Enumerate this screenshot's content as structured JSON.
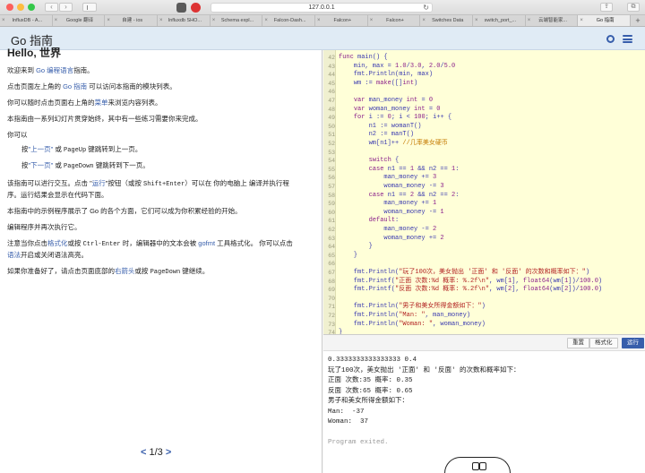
{
  "browser": {
    "url": "127.0.0.1",
    "tabs": [
      "InfluxDB - A...",
      "Google 翻译",
      "自建 - ios",
      "Influxdb SHO...",
      "Schema expl...",
      "Falcon-Dash...",
      "Falcon+",
      "Falcon+",
      "Switches Data",
      "switch_port_...",
      "云端智能家...",
      "Go 指南"
    ],
    "active_tab": 11
  },
  "app": {
    "title": "Go 指南"
  },
  "lesson": {
    "heading": "Hello, 世界",
    "p1": [
      "欢迎来到 ",
      "Go 编程语言",
      "指南。"
    ],
    "p2": [
      "点击页面左上角的 ",
      "Go 指南",
      " 可以访问本指南的模块列表。"
    ],
    "p3": [
      "你可以随时点击页面右上角的",
      "菜单",
      "来浏览内容列表。"
    ],
    "p4": "本指南由一系列幻灯片贯穿始终，其中有一些练习需要你来完成。",
    "p5": "你可以",
    "li1": [
      "按",
      "\"上一页\"",
      " 或 ",
      "PageUp",
      " 键跳转到上一页。"
    ],
    "li2": [
      "按",
      "\"下一页\"",
      " 或 ",
      "PageDown",
      " 键跳转到下一页。"
    ],
    "p6a": [
      "该指南可以进行交互。点击 \"",
      "运行",
      "\"按钮（或按 ",
      "Shift+Enter",
      "）可以在 你的电脑上 编译并执行程"
    ],
    "p6b": "序。运行结果会显示在代码下面。",
    "p7": "本指南中的示例程序展示了 Go 的各个方面，它们可以成为你积累经验的开始。",
    "p8": "编辑程序并再次执行它。",
    "p9a": [
      "注意当你点击",
      "格式化",
      "或按 ",
      "Ctrl-Enter",
      " 时，编辑器中的文本会被 ",
      "gofmt",
      " 工具格式化。 你可以点击"
    ],
    "p9b": [
      "",
      "语法",
      "开启或关闭语法高亮。"
    ],
    "p10": [
      "如果你准备好了，请点击页面底部的",
      "右箭头",
      "或按 ",
      "PageDown",
      " 键继续。"
    ],
    "pager": {
      "prev": "<",
      "page": "1/3",
      "next": ">"
    }
  },
  "editor": {
    "lines": [
      {
        "n": "42",
        "t": "func main() {"
      },
      {
        "n": "43",
        "t": "    min, max = 1.0/3.0, 2.0/5.0"
      },
      {
        "n": "44",
        "t": "    fmt.Println(min, max)"
      },
      {
        "n": "45",
        "t": "    wm := make([]int)"
      },
      {
        "n": "46",
        "t": ""
      },
      {
        "n": "47",
        "t": "    var man_money int = 0"
      },
      {
        "n": "48",
        "t": "    var woman_money int = 0"
      },
      {
        "n": "49",
        "t": "    for i := 0; i < 100; i++ {"
      },
      {
        "n": "50",
        "t": "        n1 := womanT()"
      },
      {
        "n": "51",
        "t": "        n2 := manT()"
      },
      {
        "n": "52",
        "t": "        wm[n1]++ //几率美女硬币"
      },
      {
        "n": "53",
        "t": ""
      },
      {
        "n": "54",
        "t": "        switch {"
      },
      {
        "n": "55",
        "t": "        case n1 == 1 && n2 == 1:"
      },
      {
        "n": "56",
        "t": "            man_money += 3"
      },
      {
        "n": "57",
        "t": "            woman_money -= 3"
      },
      {
        "n": "58",
        "t": "        case n1 == 2 && n2 == 2:"
      },
      {
        "n": "59",
        "t": "            man_money += 1"
      },
      {
        "n": "60",
        "t": "            woman_money -= 1"
      },
      {
        "n": "61",
        "t": "        default:"
      },
      {
        "n": "62",
        "t": "            man_money -= 2"
      },
      {
        "n": "63",
        "t": "            woman_money += 2"
      },
      {
        "n": "64",
        "t": "        }"
      },
      {
        "n": "65",
        "t": "    }"
      },
      {
        "n": "66",
        "t": ""
      },
      {
        "n": "67",
        "t": "    fmt.Println(\"玩了100次，美女抛出 '正面' 和 '反面' 的次数和概率如下：\")"
      },
      {
        "n": "68",
        "t": "    fmt.Printf(\"正面 次数:%d 概率: %.2f\\n\", wm[1], float64(wm[1])/100.0)"
      },
      {
        "n": "69",
        "t": "    fmt.Printf(\"反面 次数:%d 概率: %.2f\\n\", wm[2], float64(wm[2])/100.0)"
      },
      {
        "n": "70",
        "t": ""
      },
      {
        "n": "71",
        "t": "    fmt.Println(\"男子和美女所得金额如下：\")"
      },
      {
        "n": "72",
        "t": "    fmt.Println(\"Man: \", man_money)"
      },
      {
        "n": "73",
        "t": "    fmt.Println(\"Woman: \", woman_money)"
      },
      {
        "n": "74",
        "t": "}"
      }
    ]
  },
  "toolbar": {
    "reset": "重置",
    "format": "格式化",
    "run": "运行"
  },
  "output": {
    "lines": [
      "0.3333333333333333 0.4",
      "玩了100次，美女抛出 '正面' 和 '反面' 的次数和概率如下：",
      "正面 次数:35 概率: 0.35",
      "反面 次数:65 概率: 0.65",
      "男子和美女所得金额如下：",
      "Man:  -37",
      "Woman:  37",
      "",
      "Program exited."
    ]
  },
  "colors": {
    "accent": "#375eab",
    "header_bg": "#e0ebf5",
    "editor_bg": "#ffffd8"
  }
}
